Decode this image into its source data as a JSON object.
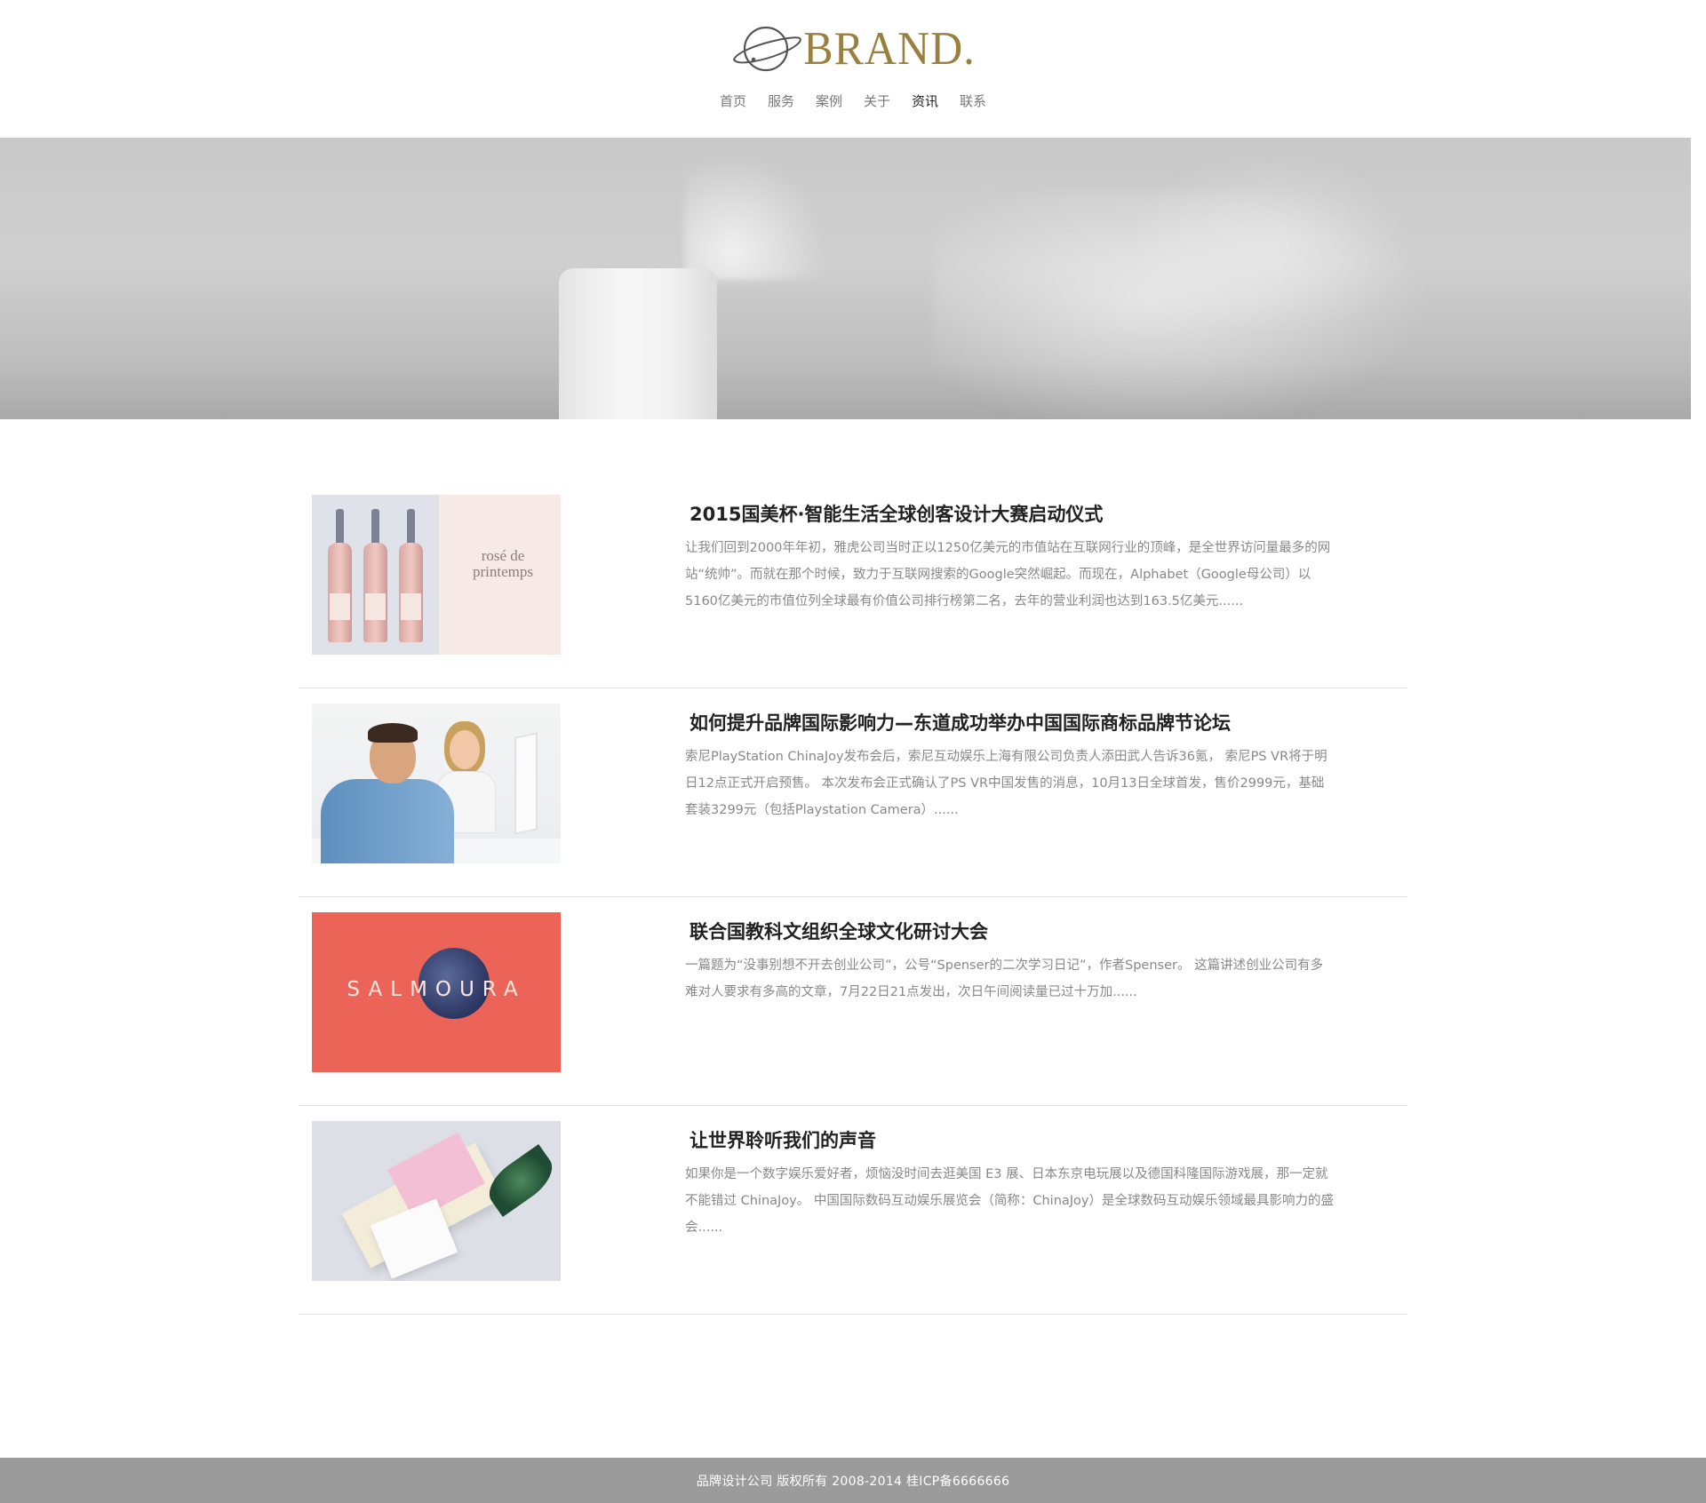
{
  "brand": {
    "logo_text": "BRAND.",
    "logo_icon": "planet-ring-icon",
    "accent_color": "#9a8040"
  },
  "nav": {
    "items": [
      {
        "label": "首页",
        "active": false
      },
      {
        "label": "服务",
        "active": false
      },
      {
        "label": "案例",
        "active": false
      },
      {
        "label": "关于",
        "active": false
      },
      {
        "label": "资讯",
        "active": true
      },
      {
        "label": "联系",
        "active": false
      }
    ]
  },
  "articles": [
    {
      "title": "2015国美杯·智能生活全球创客设计大赛启动仪式",
      "description": "让我们回到2000年年初，雅虎公司当时正以1250亿美元的市值站在互联网行业的顶峰，是全世界访问量最多的网站“统帅”。而就在那个时候，致力于互联网搜索的Google突然崛起。而现在，Alphabet（Google母公司）以5160亿美元的市值位列全球最有价值公司排行榜第二名，去年的营业利润也达到163.5亿美元......",
      "thumb_text": "rosé de printemps"
    },
    {
      "title": "如何提升品牌国际影响力—东道成功举办中国国际商标品牌节论坛",
      "description": "索尼PlayStation ChinaJoy发布会后，索尼互动娱乐上海有限公司负责人添田武人告诉36氪， 索尼PS VR将于明日12点正式开启预售。 本次发布会正式确认了PS VR中国发售的消息，10月13日全球首发，售价2999元，基础套装3299元（包括Playstation Camera）......"
    },
    {
      "title": "联合国教科文组织全球文化研讨大会",
      "description": "一篇题为“没事别想不开去创业公司”，公号“Spenser的二次学习日记”，作者Spenser。 这篇讲述创业公司有多难对人要求有多高的文章，7月22日21点发出，次日午间阅读量已过十万加......",
      "thumb_text": "SALMOURA"
    },
    {
      "title": "让世界聆听我们的声音",
      "description": "如果你是一个数字娱乐爱好者，烦恼没时间去逛美国 E3 展、日本东京电玩展以及德国科隆国际游戏展，那一定就不能错过 ChinaJoy。 中国国际数码互动娱乐展览会（简称：ChinaJoy）是全球数码互动娱乐领域最具影响力的盛会......"
    }
  ],
  "footer": {
    "text": "品牌设计公司 版权所有 2008-2014 桂ICP备6666666"
  }
}
